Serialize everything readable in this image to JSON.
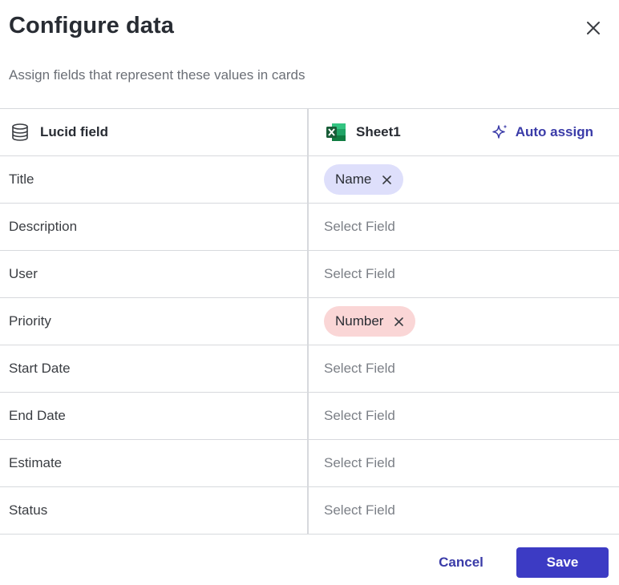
{
  "dialog": {
    "title": "Configure data",
    "subtitle": "Assign fields that represent these values in cards"
  },
  "table": {
    "left_header": "Lucid field",
    "right_header": "Sheet1",
    "auto_assign_label": "Auto assign",
    "rows": [
      {
        "field": "Title",
        "value": "Name",
        "chip_color": "#dedffb"
      },
      {
        "field": "Description",
        "value": "Select Field"
      },
      {
        "field": "User",
        "value": "Select Field"
      },
      {
        "field": "Priority",
        "value": "Number",
        "chip_color": "#fad6d6"
      },
      {
        "field": "Start Date",
        "value": "Select Field"
      },
      {
        "field": "End Date",
        "value": "Select Field"
      },
      {
        "field": "Estimate",
        "value": "Select Field"
      },
      {
        "field": "Status",
        "value": "Select Field"
      }
    ]
  },
  "footer": {
    "cancel_label": "Cancel",
    "save_label": "Save"
  },
  "colors": {
    "accent": "#3c3bc4",
    "link": "#3a3ba8",
    "excel_green": "#1d7044"
  }
}
